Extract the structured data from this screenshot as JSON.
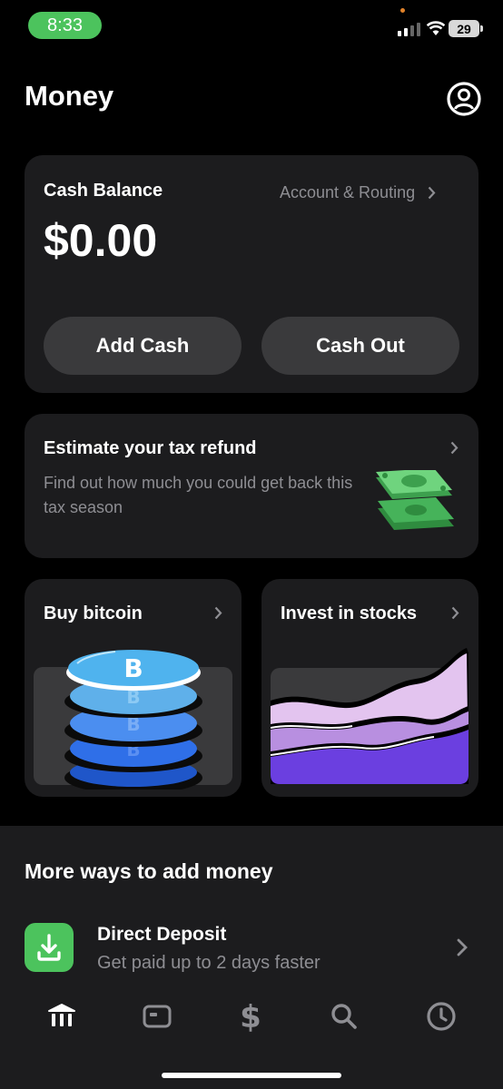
{
  "status_bar": {
    "time": "8:33",
    "battery": "29"
  },
  "header": {
    "title": "Money"
  },
  "cash_card": {
    "label": "Cash Balance",
    "account_link": "Account & Routing",
    "balance": "$0.00",
    "add_cash_label": "Add Cash",
    "cash_out_label": "Cash Out"
  },
  "tax_card": {
    "title": "Estimate your tax refund",
    "subtitle": "Find out how much you could get back this tax season"
  },
  "bitcoin_card": {
    "title": "Buy bitcoin"
  },
  "stocks_card": {
    "title": "Invest in stocks"
  },
  "more_ways": {
    "title": "More ways to add money",
    "items": [
      {
        "title": "Direct Deposit",
        "subtitle": "Get paid up to 2 days faster"
      }
    ]
  },
  "tab_bar": {
    "tabs": [
      {
        "icon": "bank-icon",
        "active": true
      },
      {
        "icon": "card-icon",
        "active": false
      },
      {
        "icon": "dollar-icon",
        "active": false
      },
      {
        "icon": "search-icon",
        "active": false
      },
      {
        "icon": "clock-icon",
        "active": false
      }
    ]
  },
  "colors": {
    "accent_green": "#4cc35d",
    "card_bg": "#1c1c1e",
    "button_bg": "#3a3a3c",
    "muted_text": "#8e8e93"
  }
}
